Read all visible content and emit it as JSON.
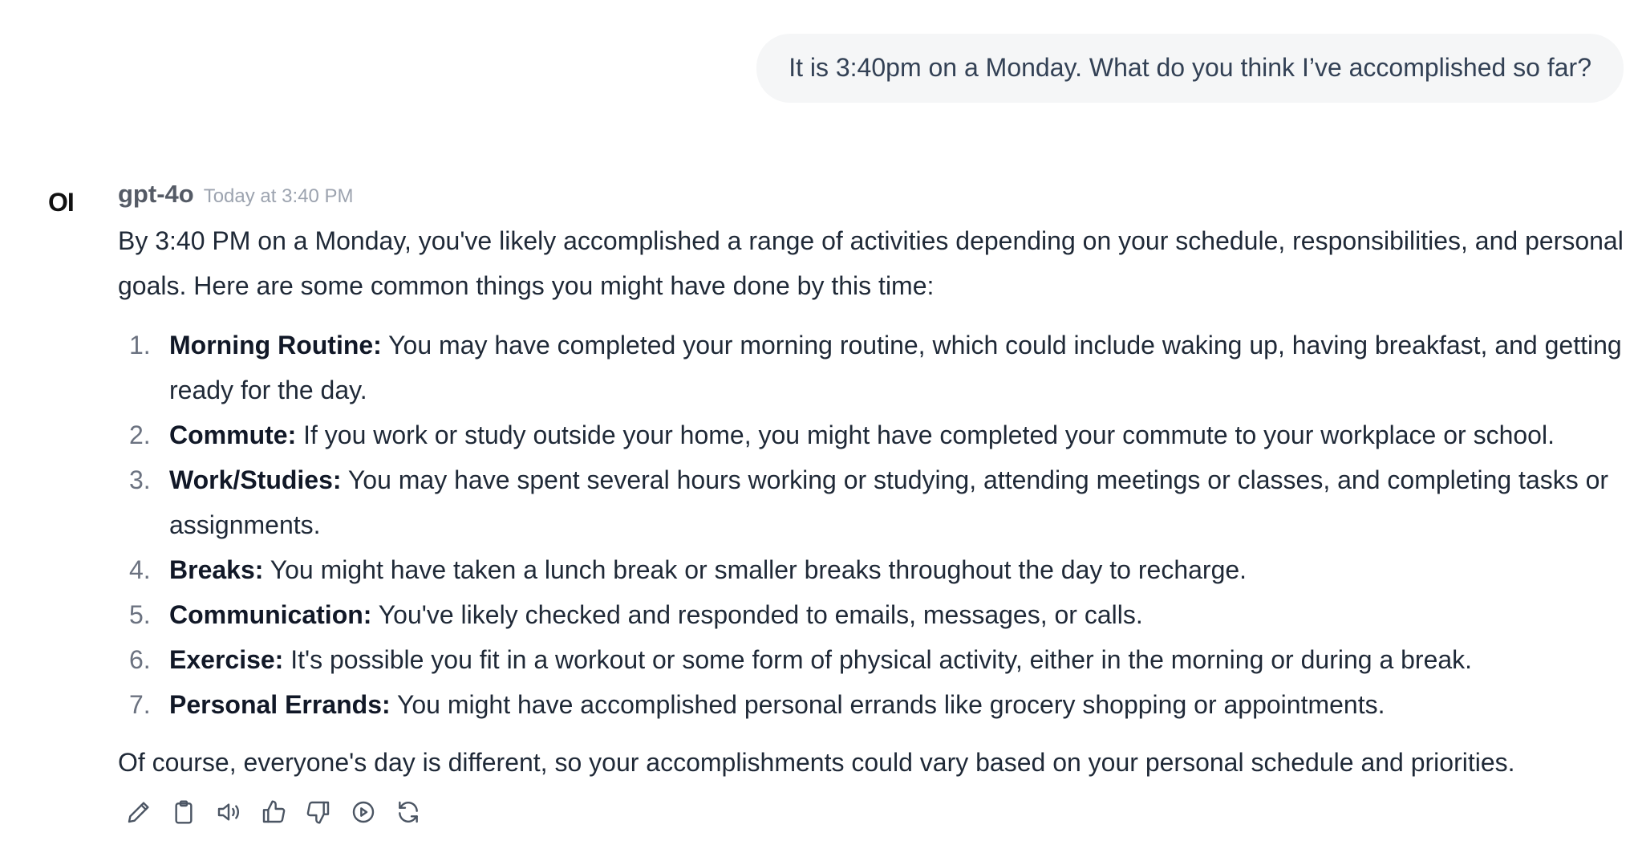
{
  "user_message": {
    "text": "It is 3:40pm on a Monday. What do you think I’ve accomplished so far?"
  },
  "assistant": {
    "avatar_text": "OI",
    "model_name": "gpt-4o",
    "timestamp": "Today at 3:40 PM",
    "intro": "By 3:40 PM on a Monday, you've likely accomplished a range of activities depending on your schedule, responsibilities, and personal goals. Here are some common things you might have done by this time:",
    "items": [
      {
        "num": "1.",
        "title": "Morning Routine:",
        "text": " You may have completed your morning routine, which could include waking up, having breakfast, and getting ready for the day."
      },
      {
        "num": "2.",
        "title": "Commute:",
        "text": " If you work or study outside your home, you might have completed your commute to your workplace or school."
      },
      {
        "num": "3.",
        "title": "Work/Studies:",
        "text": " You may have spent several hours working or studying, attending meetings or classes, and completing tasks or assignments."
      },
      {
        "num": "4.",
        "title": "Breaks:",
        "text": " You might have taken a lunch break or smaller breaks throughout the day to recharge."
      },
      {
        "num": "5.",
        "title": "Communication:",
        "text": " You've likely checked and responded to emails, messages, or calls."
      },
      {
        "num": "6.",
        "title": "Exercise:",
        "text": " It's possible you fit in a workout or some form of physical activity, either in the morning or during a break."
      },
      {
        "num": "7.",
        "title": "Personal Errands:",
        "text": " You might have accomplished personal errands like grocery shopping or appointments."
      }
    ],
    "closing": "Of course, everyone's day is different, so your accomplishments could vary based on your personal schedule and priorities.",
    "actions": [
      "edit-icon",
      "copy-icon",
      "read-aloud-icon",
      "thumbs-up-icon",
      "thumbs-down-icon",
      "continue-icon",
      "regenerate-icon"
    ]
  },
  "colors": {
    "bubble_bg": "#f5f6f7",
    "text": "#1f2937",
    "muted": "#9ca3af",
    "icon": "#4b5563"
  }
}
